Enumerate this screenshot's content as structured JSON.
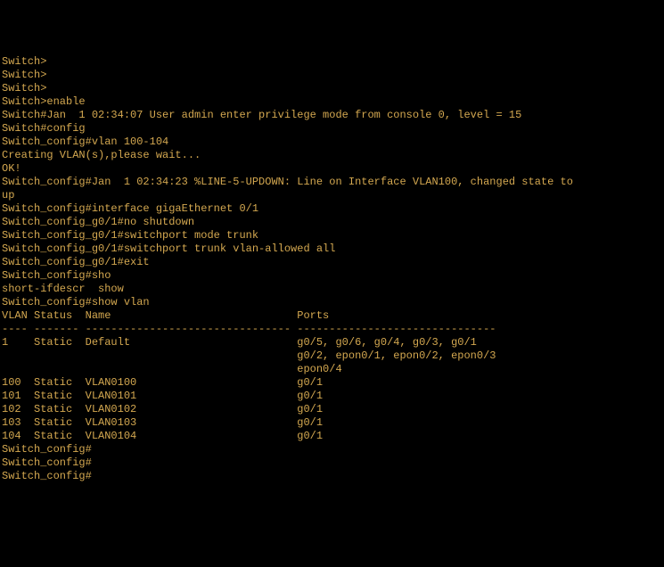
{
  "terminal": {
    "lines": [
      "Switch>",
      "Switch>",
      "Switch>",
      "Switch>enable",
      "Switch#Jan  1 02:34:07 User admin enter privilege mode from console 0, level = 15",
      "",
      "Switch#config",
      "Switch_config#vlan 100-104",
      "Creating VLAN(s),please wait...",
      "OK!",
      "Switch_config#Jan  1 02:34:23 %LINE-5-UPDOWN: Line on Interface VLAN100, changed state to",
      "up",
      "",
      "Switch_config#interface gigaEthernet 0/1",
      "Switch_config_g0/1#no shutdown",
      "Switch_config_g0/1#switchport mode trunk",
      "Switch_config_g0/1#switchport trunk vlan-allowed all",
      "Switch_config_g0/1#exit",
      "Switch_config#sho",
      "short-ifdescr  show",
      "Switch_config#show vlan",
      "VLAN Status  Name                             Ports",
      "---- ------- -------------------------------- -------------------------------",
      "1    Static  Default                          g0/5, g0/6, g0/4, g0/3, g0/1",
      "                                              g0/2, epon0/1, epon0/2, epon0/3",
      "                                              epon0/4",
      "100  Static  VLAN0100                         g0/1",
      "101  Static  VLAN0101                         g0/1",
      "102  Static  VLAN0102                         g0/1",
      "103  Static  VLAN0103                         g0/1",
      "104  Static  VLAN0104                         g0/1",
      "Switch_config#",
      "Switch_config#",
      "Switch_config#"
    ]
  },
  "colors": {
    "background": "#000000",
    "text": "#d4a850"
  }
}
